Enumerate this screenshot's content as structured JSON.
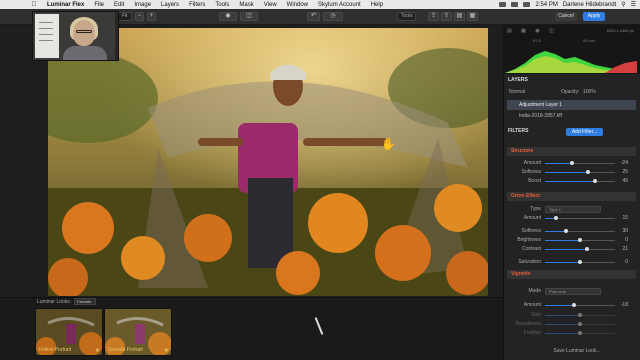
{
  "menubar": {
    "items": [
      "Luminar Flex",
      "File",
      "Edit",
      "Image",
      "Layers",
      "Filters",
      "Tools",
      "Mask",
      "View",
      "Window",
      "Skylum Account",
      "Help"
    ],
    "time": "2:54 PM",
    "user": "Darlene Hildebrandt"
  },
  "toolbar": {
    "zoom": "Fit",
    "cancel_label": "Cancel",
    "apply_label": "Apply",
    "tools_label": "Tools"
  },
  "histogram": {
    "dims": "6240 x 4160 px",
    "info_left": "f/2.8",
    "info_mid": "85 mm",
    "bit_depth": "16-bit"
  },
  "layers": {
    "title": "LAYERS",
    "blend_mode": "Normal",
    "opacity_label": "Opacity:",
    "opacity_value": "100%",
    "active_layer": "Adjustment Layer 1",
    "file_name": "India-2018-2857.tiff"
  },
  "filters": {
    "title": "FILTERS",
    "add_label": "Add Filter...",
    "structure": {
      "title": "Structure",
      "controls": [
        {
          "label": "Amount",
          "value": "-24",
          "level": 0.38
        },
        {
          "label": "Softness",
          "value": "25",
          "level": 0.62
        },
        {
          "label": "Boost",
          "value": "45",
          "level": 0.72
        }
      ]
    },
    "orton": {
      "title": "Orton Effect",
      "type_label": "Type",
      "type_value": "Type 1",
      "controls": [
        {
          "label": "Amount",
          "value": "15",
          "level": 0.15
        },
        {
          "label": "Softness",
          "value": "30",
          "level": 0.3
        },
        {
          "label": "Brightness",
          "value": "0",
          "level": 0.5
        },
        {
          "label": "Contrast",
          "value": "21",
          "level": 0.6
        },
        {
          "label": "Saturation",
          "value": "0",
          "level": 0.5
        }
      ]
    },
    "vignette": {
      "title": "Vignette",
      "mode_label": "Mode",
      "mode_value": "Post crop",
      "controls": [
        {
          "label": "Amount",
          "value": "-18",
          "level": 0.41
        },
        {
          "label": "Size",
          "value": "",
          "level": 0.5
        },
        {
          "label": "Roundness",
          "value": "",
          "level": 0.5
        },
        {
          "label": "Feather",
          "value": "",
          "level": 0.5
        }
      ]
    },
    "save_looks": "Save Luminar Look..."
  },
  "looks": {
    "title": "Luminar Looks:",
    "category": "Favorite",
    "items": [
      {
        "name": "Fellow Portrait"
      },
      {
        "name": "Smooth Portrait"
      }
    ]
  },
  "colors": {
    "accent": "#2f7de1",
    "filter_title": "#e85d3a",
    "look_label": "#e8c56a"
  }
}
